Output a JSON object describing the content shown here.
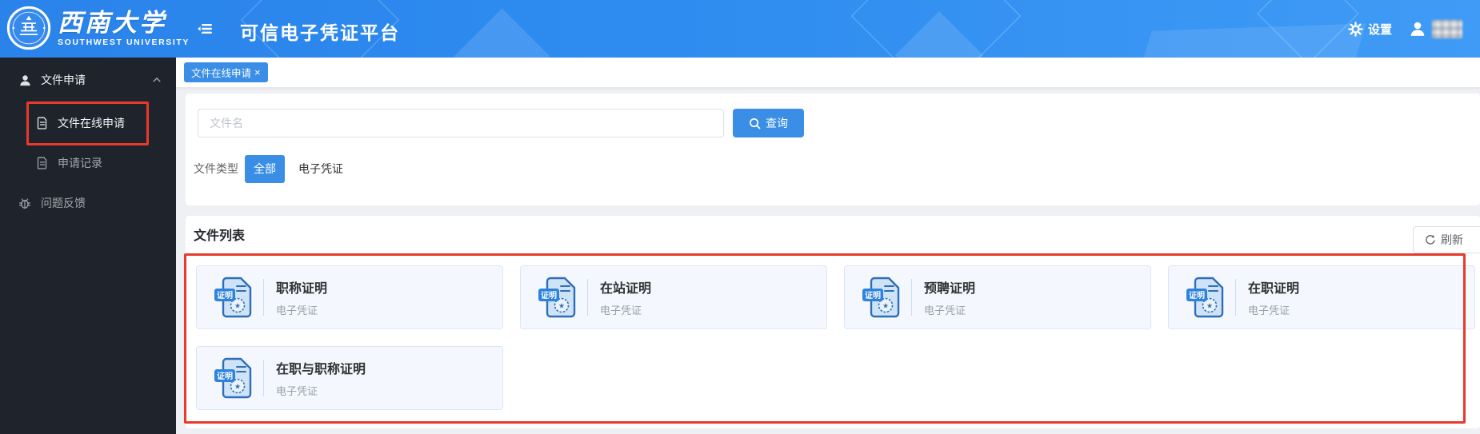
{
  "header": {
    "university_name": "西南大学",
    "university_name_en": "SOUTHWEST UNIVERSITY",
    "app_title": "可信电子凭证平台",
    "settings_label": "设置"
  },
  "sidebar": {
    "items": [
      {
        "label": "文件申请",
        "icon": "user-icon",
        "state": "expanded"
      },
      {
        "label": "文件在线申请",
        "icon": "document-icon",
        "state": "active"
      },
      {
        "label": "申请记录",
        "icon": "document-icon",
        "state": "normal"
      },
      {
        "label": "问题反馈",
        "icon": "bug-icon",
        "state": "normal"
      }
    ]
  },
  "tabs": {
    "active": {
      "label": "文件在线申请",
      "close": "×"
    }
  },
  "search": {
    "placeholder": "文件名",
    "button_label": "查询",
    "button_icon": "search-icon"
  },
  "filter": {
    "label": "文件类型",
    "options": [
      "全部",
      "电子凭证"
    ],
    "selected": "全部"
  },
  "file_list": {
    "title": "文件列表",
    "refresh_label": "刷新",
    "refresh_icon": "refresh-icon",
    "badge": "证明",
    "cards": [
      {
        "title": "职称证明",
        "type": "电子凭证"
      },
      {
        "title": "在站证明",
        "type": "电子凭证"
      },
      {
        "title": "预聘证明",
        "type": "电子凭证"
      },
      {
        "title": "在职证明",
        "type": "电子凭证"
      },
      {
        "title": "在职与职称证明",
        "type": "电子凭证"
      }
    ]
  },
  "colors": {
    "primary_blue": "#3a8ee6",
    "header_blue": "#2e8cf0",
    "sidebar_bg": "#1f232b",
    "page_bg": "#eef0f4",
    "card_bg": "#f4f8fe",
    "card_border": "#d9e6f7",
    "annotation_red": "#e8392b"
  }
}
